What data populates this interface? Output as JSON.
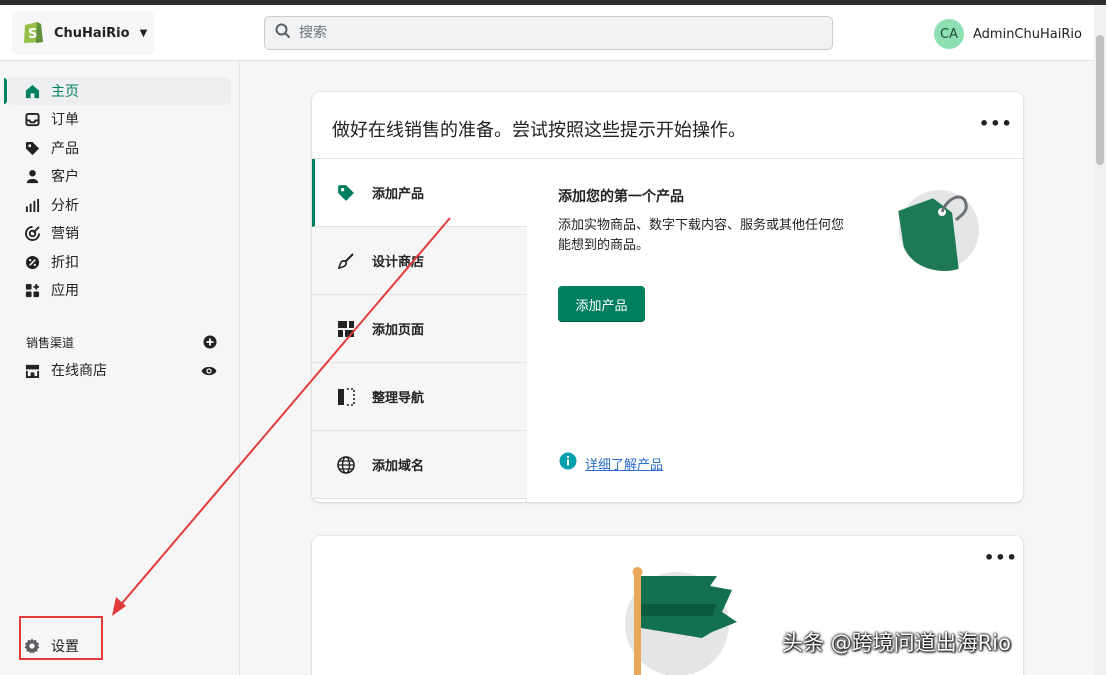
{
  "store": {
    "name": "ChuHaiRio"
  },
  "search": {
    "placeholder": "搜索"
  },
  "user": {
    "initials": "CA",
    "name": "AdminChuHaiRio"
  },
  "sidebar": {
    "items": [
      {
        "label": "主页",
        "icon": "home-icon",
        "active": true
      },
      {
        "label": "订单",
        "icon": "inbox-icon"
      },
      {
        "label": "产品",
        "icon": "tag-icon"
      },
      {
        "label": "客户",
        "icon": "person-icon"
      },
      {
        "label": "分析",
        "icon": "bar-chart-icon"
      },
      {
        "label": "营销",
        "icon": "target-icon"
      },
      {
        "label": "折扣",
        "icon": "discount-icon"
      },
      {
        "label": "应用",
        "icon": "apps-icon"
      }
    ],
    "sales_channels_label": "销售渠道",
    "online_store_label": "在线商店",
    "settings_label": "设置"
  },
  "setup_card": {
    "title": "做好在线销售的准备。尝试按照这些提示开始操作。",
    "tabs": [
      {
        "label": "添加产品",
        "icon": "tag-icon",
        "active": true
      },
      {
        "label": "设计商店",
        "icon": "brush-icon"
      },
      {
        "label": "添加页面",
        "icon": "pages-icon"
      },
      {
        "label": "整理导航",
        "icon": "navigation-icon"
      },
      {
        "label": "添加域名",
        "icon": "globe-icon"
      }
    ],
    "panel": {
      "title": "添加您的第一个产品",
      "description": "添加实物商品、数字下载内容、服务或其他任何您能想到的商品。",
      "button_label": "添加产品",
      "learn_more": "详细了解产品"
    }
  },
  "watermark": "头条 @跨境问道出海Rio",
  "colors": {
    "accent": "#008060",
    "annotation": "#e23b3b",
    "link": "#2c6ecb"
  }
}
